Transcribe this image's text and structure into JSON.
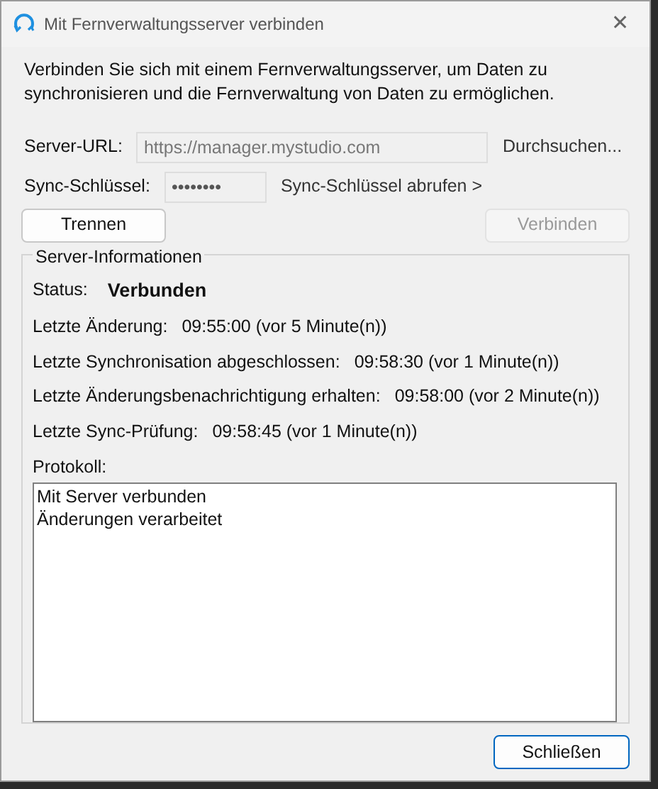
{
  "window": {
    "title": "Mit Fernverwaltungsserver verbinden",
    "close": "✕"
  },
  "description": "Verbinden Sie sich mit einem Fernverwaltungsserver, um Daten zu synchronisieren und die Fernverwaltung von Daten zu ermöglichen.",
  "server_url": {
    "label": "Server-URL:",
    "value": "https://manager.mystudio.com",
    "disabled": true,
    "browse": "Durchsuchen..."
  },
  "sync_key": {
    "label": "Sync-Schlüssel:",
    "value": "••••••••",
    "link": "Sync-Schlüssel abrufen >"
  },
  "buttons": [
    {
      "label": "Trennen",
      "disabled": false,
      "default": false
    },
    {
      "label": "Verbinden",
      "disabled": true,
      "default": false
    }
  ],
  "server_info": {
    "title": "Server-Informationen",
    "status_label": "Status:",
    "status_value": "Verbunden",
    "rows": [
      {
        "label": "Letzte Änderung:",
        "value": "09:55:00 (vor 5 Minute(n))"
      },
      {
        "label": "Letzte Synchronisation abgeschlossen:",
        "value": "09:58:30 (vor 1 Minute(n))"
      },
      {
        "label": "Letzte Änderungsbenachrichtigung erhalten:",
        "value": "09:58:00 (vor 2 Minute(n))"
      },
      {
        "label": "Letzte Sync-Prüfung:",
        "value": "09:58:45 (vor 1 Minute(n))"
      }
    ],
    "log_label": "Protokoll:",
    "log": [
      "Mit Server verbunden",
      "Änderungen verarbeitet"
    ]
  },
  "footer_button": {
    "label": "Schließen",
    "default": true
  }
}
